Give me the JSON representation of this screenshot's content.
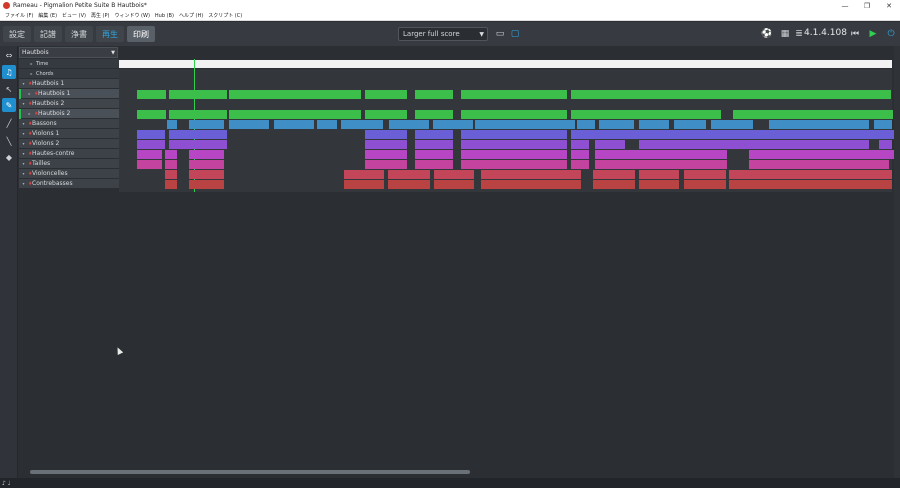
{
  "window": {
    "title": "Rameau - Pigmalion Petite Suite B Hautbois*"
  },
  "menu": [
    "ファイル (F)",
    "編集 (E)",
    "ビュー (V)",
    "再生 (P)",
    "ウィンドウ (W)",
    "Hub (B)",
    "ヘルプ (H)",
    "スクリプト (C)"
  ],
  "tabs": {
    "setup": "設定",
    "write": "記譜",
    "engrave": "浄書",
    "play": "再生",
    "print": "印刷"
  },
  "layout_select": "Larger full score",
  "version": "4.1.4.108",
  "track_header": "Hautbois",
  "tracks": [
    {
      "label": "Time",
      "type": "sys"
    },
    {
      "label": "Chords",
      "type": "sys"
    },
    {
      "label": "Hautbois 1",
      "type": "parent"
    },
    {
      "label": "Hautbois 1",
      "type": "child"
    },
    {
      "label": "Hautbois 2",
      "type": "parent"
    },
    {
      "label": "Hautbois 2",
      "type": "child"
    },
    {
      "label": "Bassons",
      "type": "inst"
    },
    {
      "label": "Violons 1",
      "type": "inst"
    },
    {
      "label": "Violons 2",
      "type": "inst"
    },
    {
      "label": "Hautes-contre",
      "type": "inst"
    },
    {
      "label": "Tailles",
      "type": "inst"
    },
    {
      "label": "Violoncelles",
      "type": "inst"
    },
    {
      "label": "Contrebasses",
      "type": "inst"
    }
  ],
  "colors": {
    "hautbois": "#3bbf4a",
    "bassons": "#3f8ec6",
    "violons1": "#6b5fd8",
    "violons2": "#8e4fd2",
    "hautes": "#b746c4",
    "tailles": "#c4439f",
    "celli": "#c2455a",
    "cb": "#b94242"
  }
}
